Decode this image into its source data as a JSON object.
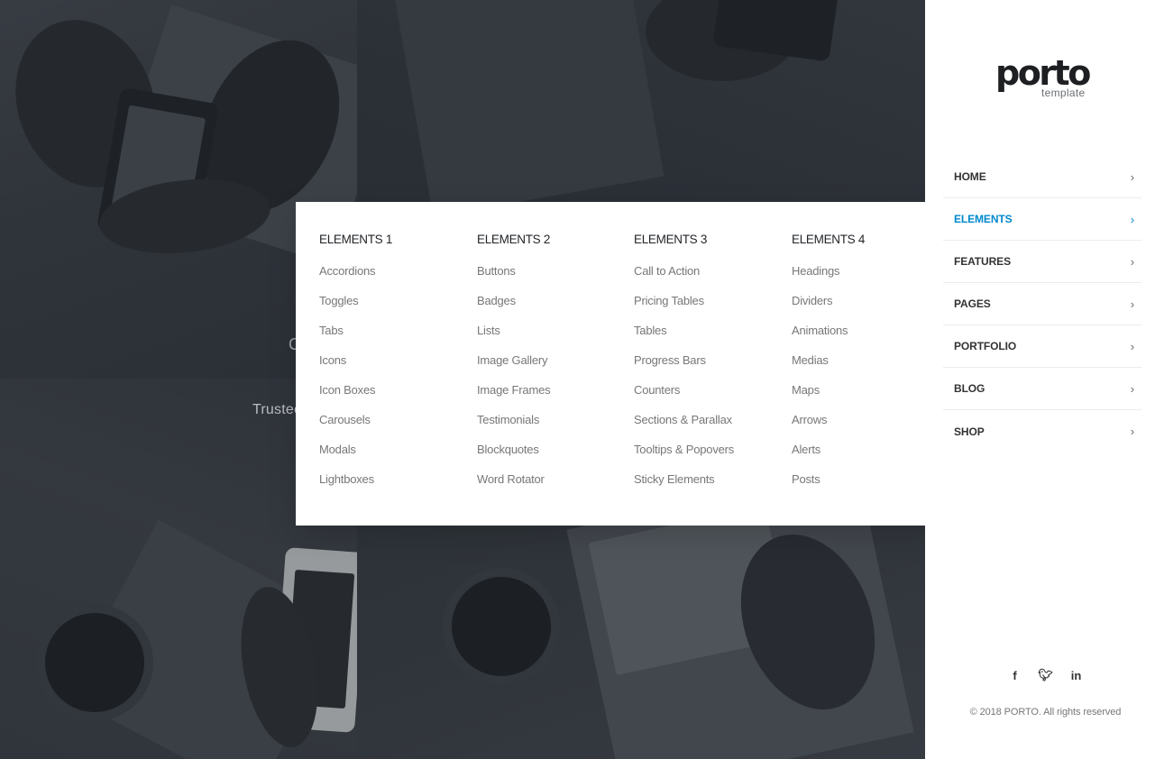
{
  "hero": {
    "fragment": "C",
    "tagline": "Trustec"
  },
  "mega_menu": {
    "columns": [
      {
        "title": "ELEMENTS 1",
        "items": [
          "Accordions",
          "Toggles",
          "Tabs",
          "Icons",
          "Icon Boxes",
          "Carousels",
          "Modals",
          "Lightboxes"
        ]
      },
      {
        "title": "ELEMENTS 2",
        "items": [
          "Buttons",
          "Badges",
          "Lists",
          "Image Gallery",
          "Image Frames",
          "Testimonials",
          "Blockquotes",
          "Word Rotator"
        ]
      },
      {
        "title": "ELEMENTS 3",
        "items": [
          "Call to Action",
          "Pricing Tables",
          "Tables",
          "Progress Bars",
          "Counters",
          "Sections & Parallax",
          "Tooltips & Popovers",
          "Sticky Elements"
        ]
      },
      {
        "title": "ELEMENTS 4",
        "items": [
          "Headings",
          "Dividers",
          "Animations",
          "Medias",
          "Maps",
          "Arrows",
          "Alerts",
          "Posts"
        ]
      }
    ]
  },
  "sidebar": {
    "logo": {
      "word": "porto",
      "sub": "template"
    },
    "nav": [
      {
        "label": "HOME",
        "active": false
      },
      {
        "label": "ELEMENTS",
        "active": true
      },
      {
        "label": "FEATURES",
        "active": false
      },
      {
        "label": "PAGES",
        "active": false
      },
      {
        "label": "PORTFOLIO",
        "active": false
      },
      {
        "label": "BLOG",
        "active": false
      },
      {
        "label": "SHOP",
        "active": false
      }
    ],
    "chevron": "›",
    "social": [
      {
        "name": "facebook-icon",
        "glyph": "f"
      },
      {
        "name": "twitter-icon",
        "glyph": "🐦︎"
      },
      {
        "name": "linkedin-icon",
        "glyph": "in"
      }
    ],
    "copyright": "© 2018 PORTO. All rights reserved"
  },
  "colors": {
    "accent": "#0088cc",
    "nav_text": "#333333",
    "menu_item": "#777777"
  }
}
